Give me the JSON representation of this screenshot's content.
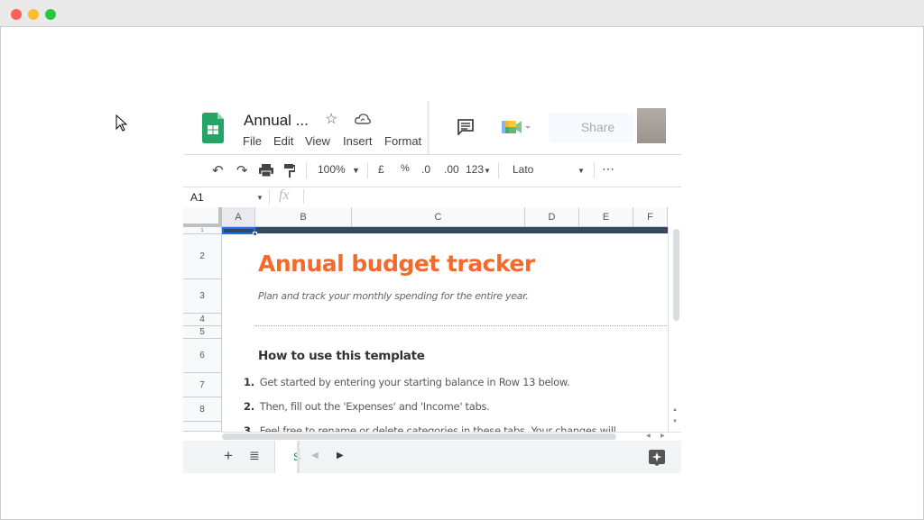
{
  "window": {
    "controls": [
      "close",
      "minimize",
      "maximize"
    ],
    "colors": {
      "close": "#fe5f57",
      "minimize": "#febc2e",
      "maximize": "#28c840"
    }
  },
  "header": {
    "title": "Annual ...",
    "menu": [
      "File",
      "Edit",
      "View",
      "Insert",
      "Format"
    ],
    "share_label": "Share",
    "brand_color": "#23a566"
  },
  "toolbar": {
    "zoom": "100%",
    "currency": "£",
    "percent": "%",
    "dec_decrease": ".0",
    "dec_increase": ".00",
    "number_format": "123",
    "font": "Lato"
  },
  "formula_bar": {
    "cell_ref": "A1",
    "fx": "fx",
    "value": ""
  },
  "columns": [
    "A",
    "B",
    "C",
    "D",
    "E",
    "F"
  ],
  "rows": [
    "1",
    "2",
    "3",
    "4",
    "5",
    "6",
    "7",
    "8"
  ],
  "sheet": {
    "title": "Annual budget tracker",
    "title_color": "#f26b2d",
    "subtitle": "Plan and track your monthly spending for the entire year.",
    "section": "How to use this template",
    "steps": [
      {
        "n": "1.",
        "text": "Get started by entering your starting balance in Row 13 below."
      },
      {
        "n": "2.",
        "text": "Then, fill out the 'Expenses' and 'Income' tabs."
      },
      {
        "n": "3.",
        "text": "Feel free to rename or delete categories in these tabs. Your changes will"
      }
    ],
    "banner_color": "#34495e"
  },
  "bottom": {
    "add": "+",
    "sheet_tab": "S"
  }
}
